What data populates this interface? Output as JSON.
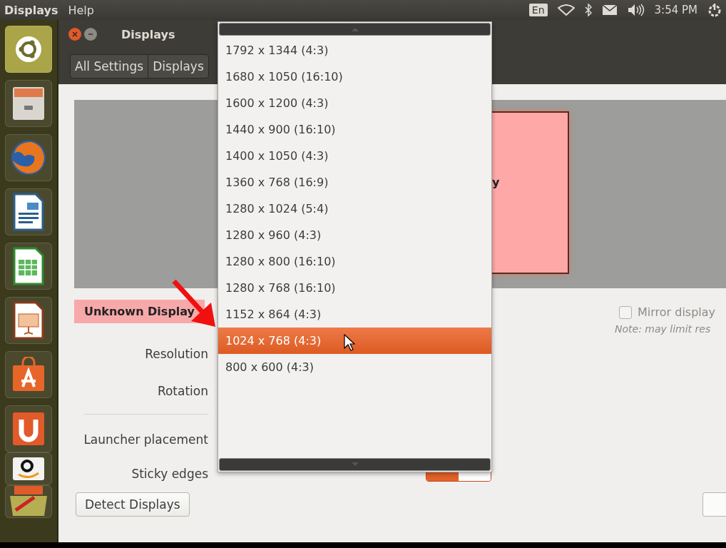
{
  "top_bar": {
    "app_name": "Displays",
    "menus": [
      "Help"
    ],
    "keyboard": "En",
    "clock": "3:54 PM"
  },
  "launcher": [
    {
      "kind": "dash"
    },
    {
      "kind": "files"
    },
    {
      "kind": "browser"
    },
    {
      "kind": "writer"
    },
    {
      "kind": "calc"
    },
    {
      "kind": "impress"
    },
    {
      "kind": "store"
    },
    {
      "kind": "u"
    },
    {
      "kind": "amazon"
    },
    {
      "kind": "stack"
    }
  ],
  "window": {
    "title": "Displays",
    "breadcrumbs": [
      "All Settings",
      "Displays"
    ]
  },
  "monitor": {
    "label": "y"
  },
  "display_name": "Unknown Display",
  "mirror": {
    "label": "Mirror display",
    "checked": false,
    "note": "Note: may limit res"
  },
  "settings": [
    {
      "label": "Resolution"
    },
    {
      "label": "Rotation"
    },
    {
      "label": "Launcher placement"
    },
    {
      "label": "Sticky edges",
      "kind": "switch",
      "on": true
    }
  ],
  "buttons": [
    "Detect Displays"
  ],
  "dropdown": [
    {
      "label": "1792 x 1344 (4:3)",
      "selected": false
    },
    {
      "label": "1680 x 1050 (16:10)",
      "selected": false
    },
    {
      "label": "1600 x 1200 (4:3)",
      "selected": false
    },
    {
      "label": "1440 x 900 (16:10)",
      "selected": false
    },
    {
      "label": "1400 x 1050 (4:3)",
      "selected": false
    },
    {
      "label": "1360 x 768 (16:9)",
      "selected": false
    },
    {
      "label": "1280 x 1024 (5:4)",
      "selected": false
    },
    {
      "label": "1280 x 960 (4:3)",
      "selected": false
    },
    {
      "label": "1280 x 800 (16:10)",
      "selected": false
    },
    {
      "label": "1280 x 768 (16:10)",
      "selected": false
    },
    {
      "label": "1152 x 864 (4:3)",
      "selected": false
    },
    {
      "label": "1024 x 768 (4:3)",
      "selected": true
    },
    {
      "label": "800 x 600 (4:3)",
      "selected": false
    }
  ]
}
